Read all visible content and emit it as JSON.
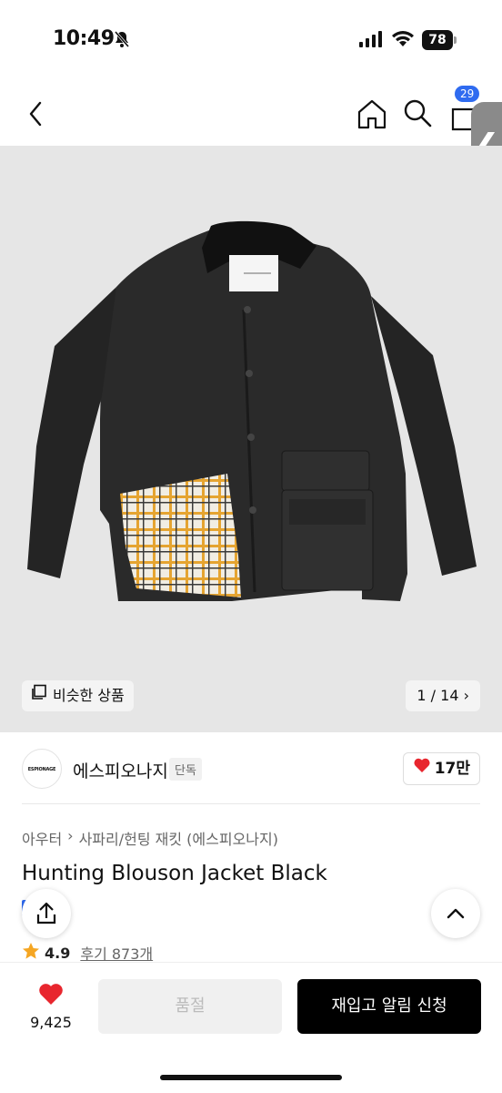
{
  "status_bar": {
    "time": "10:49",
    "battery": "78"
  },
  "header": {
    "cart_badge": "29"
  },
  "side_tab": {
    "glyph": "❮"
  },
  "gallery": {
    "similar_label": "비슷한 상품",
    "counter": "1 / 14",
    "counter_arrow": "›"
  },
  "brand": {
    "logo_text": "ESPIONAGE",
    "name": "에스피오나지",
    "exclusive_badge": "단독",
    "likes": "17만"
  },
  "breadcrumbs": [
    "아우터",
    "›",
    "사파리/헌팅 재킷 (에스피오나지)"
  ],
  "product": {
    "title": "Hunting Blouson Jacket Black",
    "rating": "4.9",
    "reviews": "후기 873개"
  },
  "bottom_bar": {
    "wish_count": "9,425",
    "soldout_label": "품절",
    "restock_label": "재입고 알림 신청"
  },
  "colors": {
    "accent_blue": "#2f6bf0",
    "heart_red": "#e8262e",
    "star": "#f5a623"
  }
}
